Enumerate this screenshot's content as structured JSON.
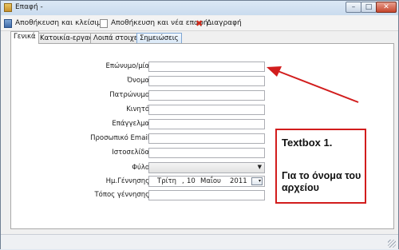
{
  "window": {
    "title": "Επαφή -"
  },
  "titlebar": {
    "minimize": "–",
    "maximize": "□",
    "close": "✕"
  },
  "toolbar": {
    "save_close_label": "Αποθήκευση και κλείσιμο",
    "save_new_label": "Αποθήκευση και νέα επαφή",
    "delete_label": "Διαγραφή",
    "delete_glyph": "✖"
  },
  "tabs": [
    {
      "label": "Γενικά"
    },
    {
      "label": "Κατοικία-εργασία"
    },
    {
      "label": "Λοιπά στοιχεία"
    },
    {
      "label": "Σημειώσεις"
    }
  ],
  "form": {
    "surname_label": "Επώνυμο/μία:",
    "name_label": "Όνομα:",
    "patronymic_label": "Πατρώνυμο:",
    "mobile_label": "Κινητό:",
    "occupation_label": "Επάγγελμα:",
    "email_label": "Προσωπικό Email:",
    "website_label": "Ιστοσελίδα:",
    "gender_label": "Φύλο:",
    "gender_value": "",
    "gender_arrow": "▼",
    "birthdate_label": "Ημ.Γέννησης:",
    "birthdate": {
      "weekday": "Τρίτη",
      "sep": ",",
      "day": "10",
      "month": "Μαΐου",
      "year": "2011"
    },
    "birthplace_label": "Τόπος γέννησης:"
  },
  "annotation": {
    "title": "Textbox 1.",
    "body": "Για το όνομα του αρχείου",
    "color": "#d21d1d"
  }
}
